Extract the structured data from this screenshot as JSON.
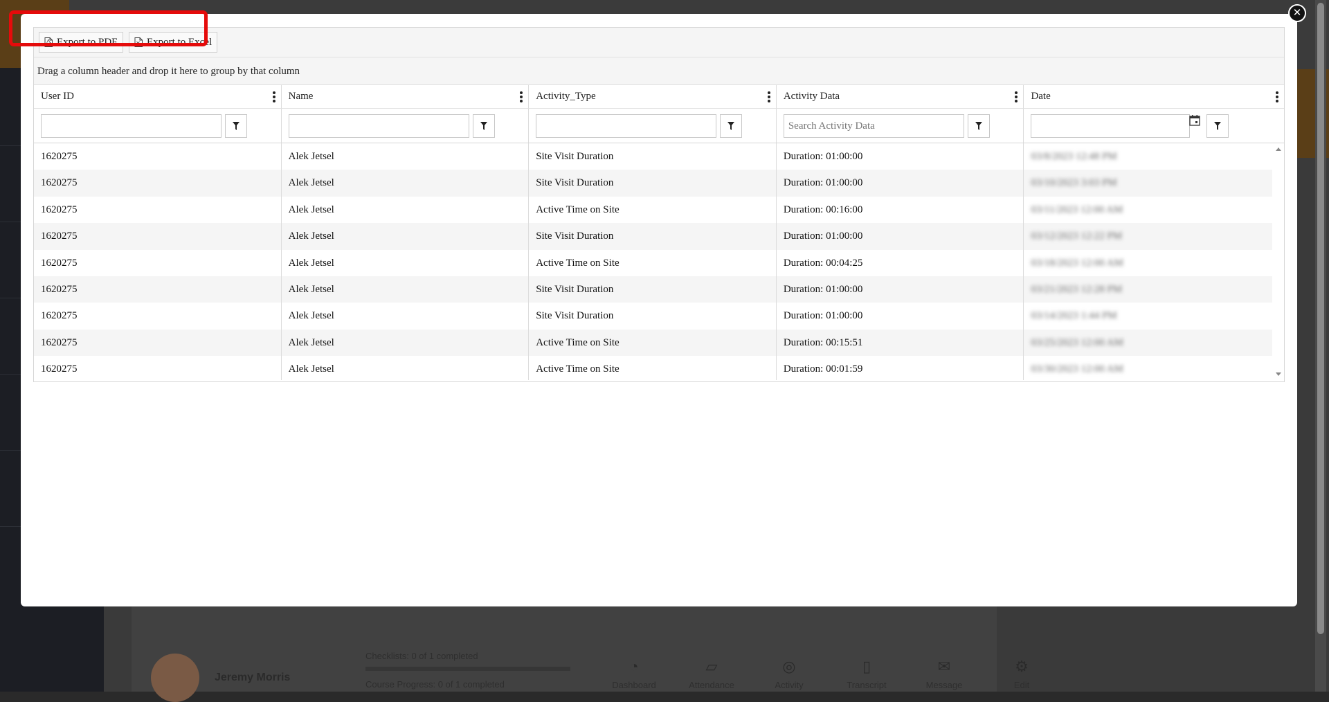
{
  "background": {
    "profile_name": "Jeremy Morris",
    "checklists": "Checklists: 0 of 1 completed",
    "course_progress": "Course Progress: 0 of 1 completed",
    "actions": [
      {
        "label": "Dashboard",
        "icon": "dashboard-icon"
      },
      {
        "label": "Attendance",
        "icon": "attendance-icon"
      },
      {
        "label": "Activity",
        "icon": "activity-icon"
      },
      {
        "label": "Transcript",
        "icon": "transcript-icon"
      },
      {
        "label": "Message",
        "icon": "message-icon"
      },
      {
        "label": "Edit",
        "icon": "gear-icon"
      }
    ]
  },
  "modal": {
    "close_icon": "close-icon",
    "toolbar": {
      "export_pdf": "Export to PDF",
      "export_excel": "Export to Excel",
      "highlight_color": "#e50b0b"
    },
    "group_panel": "Drag a column header and drop it here to group by that column",
    "columns": [
      {
        "label": "User ID",
        "filter_placeholder": ""
      },
      {
        "label": "Name",
        "filter_placeholder": ""
      },
      {
        "label": "Activity_Type",
        "filter_placeholder": ""
      },
      {
        "label": "Activity Data",
        "filter_placeholder": "Search Activity Data"
      },
      {
        "label": "Date",
        "filter_placeholder": ""
      }
    ],
    "rows": [
      {
        "user_id": "1620275",
        "name": "Alek Jetsel",
        "type": "Site Visit Duration",
        "data": "Duration: 01:00:00",
        "date": "03/8/2023 12:48 PM"
      },
      {
        "user_id": "1620275",
        "name": "Alek Jetsel",
        "type": "Site Visit Duration",
        "data": "Duration: 01:00:00",
        "date": "03/10/2023 3:03 PM"
      },
      {
        "user_id": "1620275",
        "name": "Alek Jetsel",
        "type": "Active Time on Site",
        "data": "Duration: 00:16:00",
        "date": "03/11/2023 12:00 AM"
      },
      {
        "user_id": "1620275",
        "name": "Alek Jetsel",
        "type": "Site Visit Duration",
        "data": "Duration: 01:00:00",
        "date": "03/12/2023 12:22 PM"
      },
      {
        "user_id": "1620275",
        "name": "Alek Jetsel",
        "type": "Active Time on Site",
        "data": "Duration: 00:04:25",
        "date": "03/18/2023 12:00 AM"
      },
      {
        "user_id": "1620275",
        "name": "Alek Jetsel",
        "type": "Site Visit Duration",
        "data": "Duration: 01:00:00",
        "date": "03/21/2023 12:28 PM"
      },
      {
        "user_id": "1620275",
        "name": "Alek Jetsel",
        "type": "Site Visit Duration",
        "data": "Duration: 01:00:00",
        "date": "03/14/2023 1:44 PM"
      },
      {
        "user_id": "1620275",
        "name": "Alek Jetsel",
        "type": "Active Time on Site",
        "data": "Duration: 00:15:51",
        "date": "03/25/2023 12:00 AM"
      },
      {
        "user_id": "1620275",
        "name": "Alek Jetsel",
        "type": "Active Time on Site",
        "data": "Duration: 00:01:59",
        "date": "03/30/2023 12:00 AM"
      }
    ]
  }
}
